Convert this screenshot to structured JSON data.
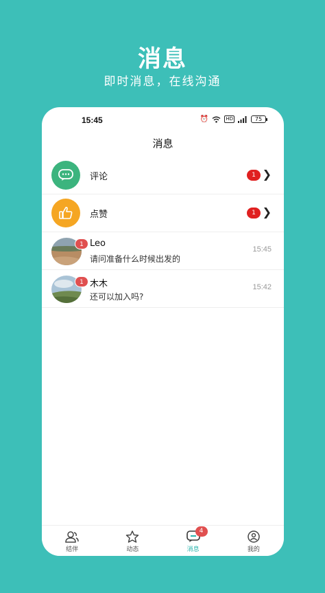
{
  "hero": {
    "title": "消息",
    "subtitle": "即时消息，在线沟通"
  },
  "status": {
    "time": "15:45",
    "battery": "75"
  },
  "page": {
    "title": "消息"
  },
  "notifications": [
    {
      "label": "评论",
      "count": "1",
      "color": "#3cb47e",
      "icon": "chat-bubble-icon"
    },
    {
      "label": "点赞",
      "count": "1",
      "color": "#f5a623",
      "icon": "thumbs-up-icon"
    }
  ],
  "chats": [
    {
      "name": "Leo",
      "message": "请问准备什么时候出发的",
      "time": "15:45",
      "unread": "1"
    },
    {
      "name": "木木",
      "message": "还可以加入吗?",
      "time": "15:42",
      "unread": "1"
    }
  ],
  "tabs": [
    {
      "label": "结伴",
      "icon": "people-icon",
      "active": false
    },
    {
      "label": "动态",
      "icon": "star-icon",
      "active": false
    },
    {
      "label": "消息",
      "icon": "message-icon",
      "active": true,
      "badge": "4"
    },
    {
      "label": "我的",
      "icon": "profile-icon",
      "active": false
    }
  ],
  "colors": {
    "background": "#3dbfb8",
    "accent": "#2ab5ad",
    "badge": "#e02020"
  }
}
